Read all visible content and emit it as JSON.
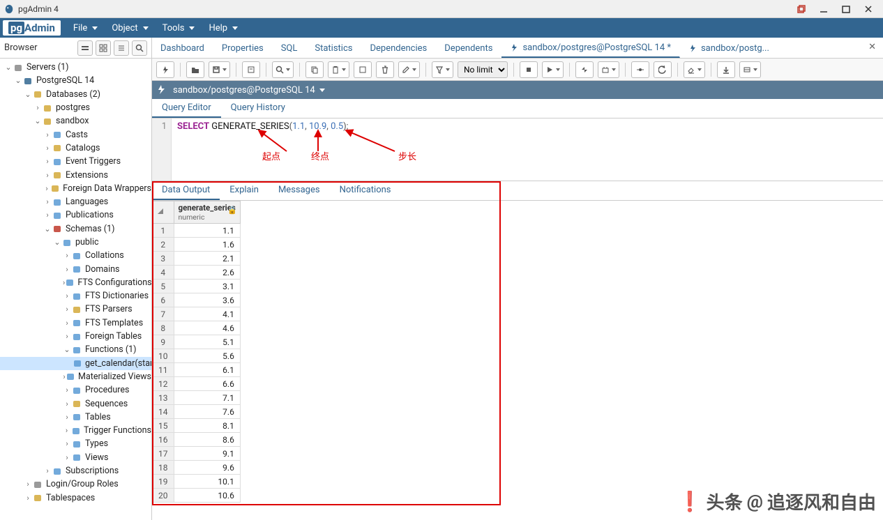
{
  "app_title": "pgAdmin 4",
  "logo_text_pg": "pg",
  "logo_text_admin": "Admin",
  "menu": {
    "file": "File",
    "object": "Object",
    "tools": "Tools",
    "help": "Help"
  },
  "browser": {
    "header": "Browser",
    "tree": [
      {
        "depth": 0,
        "caret": "v",
        "icon": "server-grp",
        "label": "Servers (1)"
      },
      {
        "depth": 1,
        "caret": "v",
        "icon": "pg",
        "label": "PostgreSQL 14"
      },
      {
        "depth": 2,
        "caret": "v",
        "icon": "db-grp",
        "label": "Databases (2)"
      },
      {
        "depth": 3,
        "caret": ">",
        "icon": "db",
        "label": "postgres"
      },
      {
        "depth": 3,
        "caret": "v",
        "icon": "db",
        "label": "sandbox"
      },
      {
        "depth": 4,
        "caret": ">",
        "icon": "cast",
        "label": "Casts"
      },
      {
        "depth": 4,
        "caret": ">",
        "icon": "catalog",
        "label": "Catalogs"
      },
      {
        "depth": 4,
        "caret": ">",
        "icon": "event",
        "label": "Event Triggers"
      },
      {
        "depth": 4,
        "caret": ">",
        "icon": "ext",
        "label": "Extensions"
      },
      {
        "depth": 4,
        "caret": ">",
        "icon": "fdw",
        "label": "Foreign Data Wrappers"
      },
      {
        "depth": 4,
        "caret": ">",
        "icon": "lang",
        "label": "Languages"
      },
      {
        "depth": 4,
        "caret": ">",
        "icon": "pub",
        "label": "Publications"
      },
      {
        "depth": 4,
        "caret": "v",
        "icon": "schema",
        "label": "Schemas (1)"
      },
      {
        "depth": 5,
        "caret": "v",
        "icon": "public",
        "label": "public"
      },
      {
        "depth": 6,
        "caret": ">",
        "icon": "coll",
        "label": "Collations"
      },
      {
        "depth": 6,
        "caret": ">",
        "icon": "dom",
        "label": "Domains"
      },
      {
        "depth": 6,
        "caret": ">",
        "icon": "ftsc",
        "label": "FTS Configurations"
      },
      {
        "depth": 6,
        "caret": ">",
        "icon": "ftsd",
        "label": "FTS Dictionaries"
      },
      {
        "depth": 6,
        "caret": ">",
        "icon": "ftsp",
        "label": "FTS Parsers"
      },
      {
        "depth": 6,
        "caret": ">",
        "icon": "ftst",
        "label": "FTS Templates"
      },
      {
        "depth": 6,
        "caret": ">",
        "icon": "ft",
        "label": "Foreign Tables"
      },
      {
        "depth": 6,
        "caret": "v",
        "icon": "func",
        "label": "Functions (1)"
      },
      {
        "depth": 7,
        "caret": "",
        "icon": "fn",
        "label": "get_calendar(start_",
        "sel": true
      },
      {
        "depth": 6,
        "caret": ">",
        "icon": "mv",
        "label": "Materialized Views"
      },
      {
        "depth": 6,
        "caret": ">",
        "icon": "proc",
        "label": "Procedures"
      },
      {
        "depth": 6,
        "caret": ">",
        "icon": "seq",
        "label": "Sequences"
      },
      {
        "depth": 6,
        "caret": ">",
        "icon": "table",
        "label": "Tables"
      },
      {
        "depth": 6,
        "caret": ">",
        "icon": "trig",
        "label": "Trigger Functions"
      },
      {
        "depth": 6,
        "caret": ">",
        "icon": "type",
        "label": "Types"
      },
      {
        "depth": 6,
        "caret": ">",
        "icon": "view",
        "label": "Views"
      },
      {
        "depth": 4,
        "caret": ">",
        "icon": "sub",
        "label": "Subscriptions"
      },
      {
        "depth": 2,
        "caret": ">",
        "icon": "login",
        "label": "Login/Group Roles"
      },
      {
        "depth": 2,
        "caret": ">",
        "icon": "ts",
        "label": "Tablespaces"
      }
    ]
  },
  "tabs": {
    "items": [
      {
        "label": "Dashboard"
      },
      {
        "label": "Properties"
      },
      {
        "label": "SQL"
      },
      {
        "label": "Statistics"
      },
      {
        "label": "Dependencies"
      },
      {
        "label": "Dependents"
      },
      {
        "label": "sandbox/postgres@PostgreSQL 14 *",
        "icon": "query",
        "active": true
      },
      {
        "label": "sandbox/postg...",
        "icon": "query"
      }
    ]
  },
  "context_path": "sandbox/postgres@PostgreSQL 14",
  "toolbar": {
    "limit_label": "No limit"
  },
  "subtabs": {
    "editor": "Query Editor",
    "history": "Query History"
  },
  "query": {
    "line_no": "1",
    "select": "SELECT",
    "fn": "GENERATE_SERIES",
    "paren_open": "(",
    "arg1": "1.1",
    "comma1": ", ",
    "arg2": "10.9",
    "comma2": ", ",
    "arg3": "0.5",
    "paren_close": ");"
  },
  "annotations": {
    "start": "起点",
    "end": "终点",
    "step": "步长"
  },
  "result_tabs": {
    "data": "Data Output",
    "explain": "Explain",
    "messages": "Messages",
    "notif": "Notifications"
  },
  "column": {
    "name": "generate_series",
    "type": "numeric"
  },
  "rows": [
    {
      "n": "1",
      "v": "1.1"
    },
    {
      "n": "2",
      "v": "1.6"
    },
    {
      "n": "3",
      "v": "2.1"
    },
    {
      "n": "4",
      "v": "2.6"
    },
    {
      "n": "5",
      "v": "3.1"
    },
    {
      "n": "6",
      "v": "3.6"
    },
    {
      "n": "7",
      "v": "4.1"
    },
    {
      "n": "8",
      "v": "4.6"
    },
    {
      "n": "9",
      "v": "5.1"
    },
    {
      "n": "10",
      "v": "5.6"
    },
    {
      "n": "11",
      "v": "6.1"
    },
    {
      "n": "12",
      "v": "6.6"
    },
    {
      "n": "13",
      "v": "7.1"
    },
    {
      "n": "14",
      "v": "7.6"
    },
    {
      "n": "15",
      "v": "8.1"
    },
    {
      "n": "16",
      "v": "8.6"
    },
    {
      "n": "17",
      "v": "9.1"
    },
    {
      "n": "18",
      "v": "9.6"
    },
    {
      "n": "19",
      "v": "10.1"
    },
    {
      "n": "20",
      "v": "10.6"
    }
  ],
  "watermark": {
    "prefix": "头条",
    "at": "@",
    "name": "追逐风和自由"
  }
}
